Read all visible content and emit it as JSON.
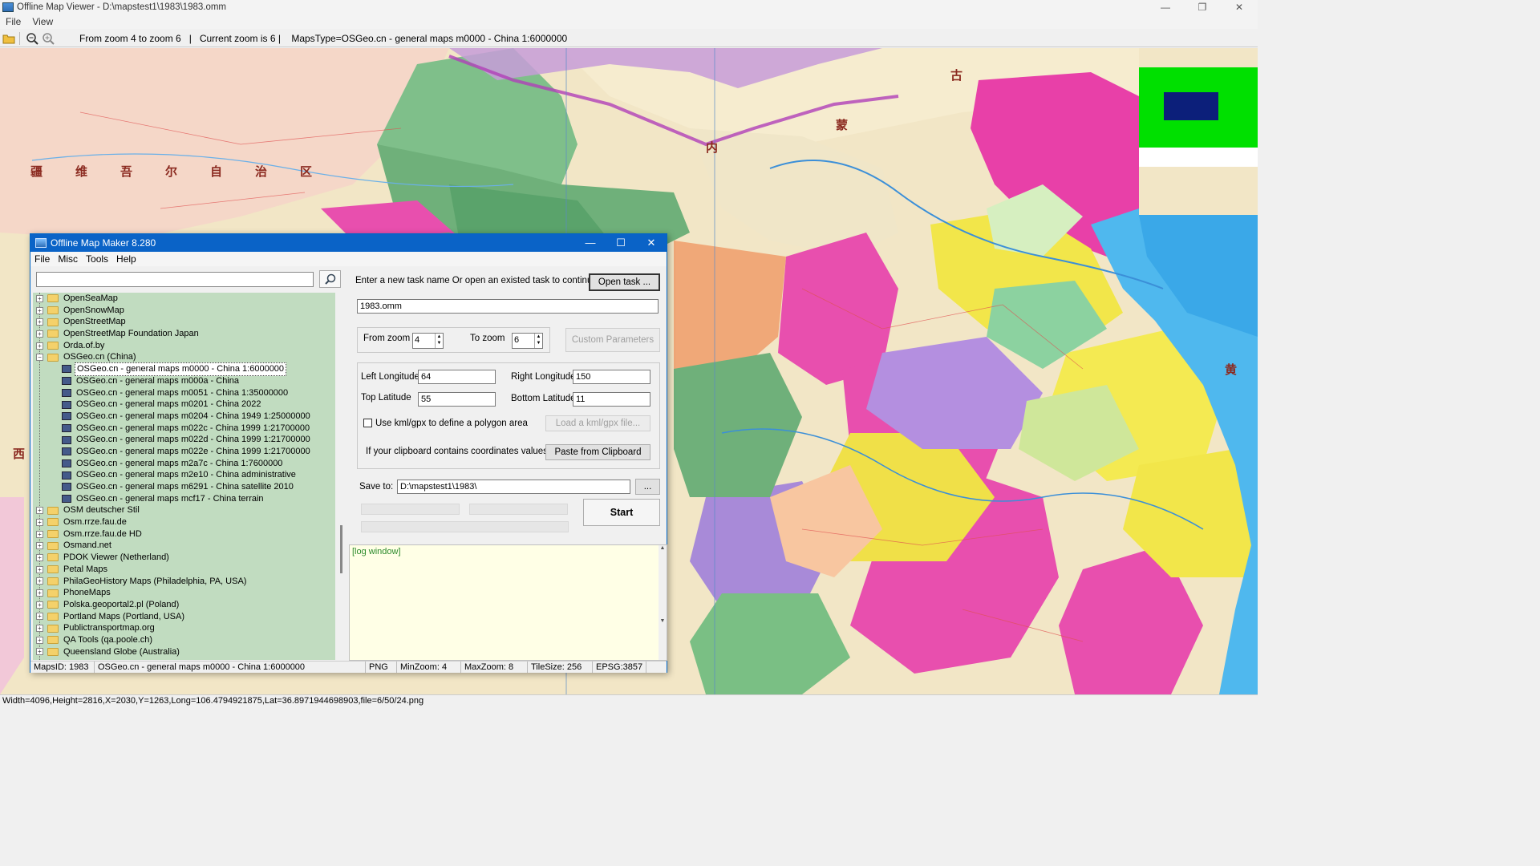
{
  "window": {
    "title": "Offline Map Viewer - D:\\mapstest1\\1983\\1983.omm",
    "controls": {
      "minimize": "—",
      "restore": "❐",
      "close": "✕"
    }
  },
  "menu": {
    "file": "File",
    "view": "View"
  },
  "toolbar": {
    "info": "From zoom 4 to zoom 6   |   Current zoom is 6 |    MapsType=OSGeo.cn - general maps m0000 - China 1:6000000"
  },
  "map_labels": [
    {
      "text": "疆"
    },
    {
      "text": "维"
    },
    {
      "text": "吾"
    },
    {
      "text": "尔"
    },
    {
      "text": "自"
    },
    {
      "text": "治"
    },
    {
      "text": "区"
    },
    {
      "text": "内"
    },
    {
      "text": "古"
    },
    {
      "text": "蒙"
    },
    {
      "text": "黄"
    },
    {
      "text": "西"
    }
  ],
  "status": {
    "text": "Width=4096,Height=2816,X=2030,Y=1263,Long=106.4794921875,Lat=36.8971944698903,file=6/50/24.png"
  },
  "dialog": {
    "title": "Offline Map Maker 8.280",
    "controls": {
      "minimize": "—",
      "maximize": "☐",
      "close": "✕"
    },
    "menu": {
      "file": "File",
      "misc": "Misc",
      "tools": "Tools",
      "help": "Help"
    },
    "search": {
      "value": "",
      "placeholder": ""
    },
    "tree": {
      "folders_top": [
        {
          "label": "OpenSeaMap",
          "exp": "+"
        },
        {
          "label": "OpenSnowMap",
          "exp": "+"
        },
        {
          "label": "OpenStreetMap",
          "exp": "+"
        },
        {
          "label": "OpenStreetMap Foundation Japan",
          "exp": "+"
        },
        {
          "label": "Orda.of.by",
          "exp": "+"
        },
        {
          "label": "OSGeo.cn (China)",
          "exp": "−"
        }
      ],
      "children": [
        "OSGeo.cn - general maps m0000 - China 1:6000000",
        "OSGeo.cn - general maps m000a - China",
        "OSGeo.cn - general maps m0051 - China 1:35000000",
        "OSGeo.cn - general maps m0201 - China 2022",
        "OSGeo.cn - general maps m0204 - China 1949 1:25000000",
        "OSGeo.cn - general maps m022c - China 1999 1:21700000",
        "OSGeo.cn - general maps m022d - China 1999 1:21700000",
        "OSGeo.cn - general maps m022e - China 1999 1:21700000",
        "OSGeo.cn - general maps m2a7c - China 1:7600000",
        "OSGeo.cn - general maps m2e10 - China administrative",
        "OSGeo.cn - general maps m6291 - China satellite 2010",
        "OSGeo.cn - general maps mcf17 - China terrain"
      ],
      "folders_bottom": [
        {
          "label": "OSM deutscher Stil",
          "exp": "+"
        },
        {
          "label": "Osm.rrze.fau.de",
          "exp": "+"
        },
        {
          "label": "Osm.rrze.fau.de HD",
          "exp": "+"
        },
        {
          "label": "Osmand.net",
          "exp": "+"
        },
        {
          "label": "PDOK Viewer (Netherland)",
          "exp": "+"
        },
        {
          "label": "Petal Maps",
          "exp": "+"
        },
        {
          "label": "PhilaGeoHistory Maps (Philadelphia, PA, USA)",
          "exp": "+"
        },
        {
          "label": "PhoneMaps",
          "exp": "+"
        },
        {
          "label": "Polska.geoportal2.pl (Poland)",
          "exp": "+"
        },
        {
          "label": "Portland Maps (Portland, USA)",
          "exp": "+"
        },
        {
          "label": "Publictransportmap.org",
          "exp": "+"
        },
        {
          "label": "QA Tools (qa.poole.ch)",
          "exp": "+"
        },
        {
          "label": "Queensland Globe (Australia)",
          "exp": "+"
        }
      ]
    },
    "task": {
      "prompt": "Enter a new task name Or open an existed task to continue:",
      "open_button": "Open task ...",
      "name_value": "1983.omm"
    },
    "zoom": {
      "from_label": "From zoom",
      "from_value": "4",
      "to_label": "To zoom",
      "to_value": "6",
      "custom_button": "Custom Parameters"
    },
    "coords": {
      "left_lon_label": "Left Longitude",
      "left_lon": "64",
      "right_lon_label": "Right Longitude",
      "right_lon": "150",
      "top_lat_label": "Top Latitude",
      "top_lat": "55",
      "bottom_lat_label": "Bottom Latitude",
      "bottom_lat": "11",
      "kml_label": "Use kml/gpx to define a polygon area",
      "kml_button": "Load a kml/gpx file...",
      "clipboard_label": "If your clipboard contains coordinates values:",
      "clipboard_button": "Paste from Clipboard"
    },
    "save": {
      "label": "Save to:",
      "path": "D:\\mapstest1\\1983\\",
      "browse": "..."
    },
    "start_button": "Start",
    "log": "[log window]",
    "statusbar": {
      "maps_id": "MapsID: 1983",
      "maps_name": "OSGeo.cn - general maps m0000 - China 1:6000000",
      "format": "PNG",
      "min_zoom": "MinZoom: 4",
      "max_zoom": "MaxZoom: 8",
      "tile_size": "TileSize: 256",
      "epsg": "EPSG:3857"
    }
  },
  "colors": {
    "dialog_title": "#0a63c7",
    "tree_bg": "#c1dcc0",
    "log_bg": "#ffffe6",
    "minimap": "#00e000",
    "minimap_view": "#0c1f7a"
  }
}
